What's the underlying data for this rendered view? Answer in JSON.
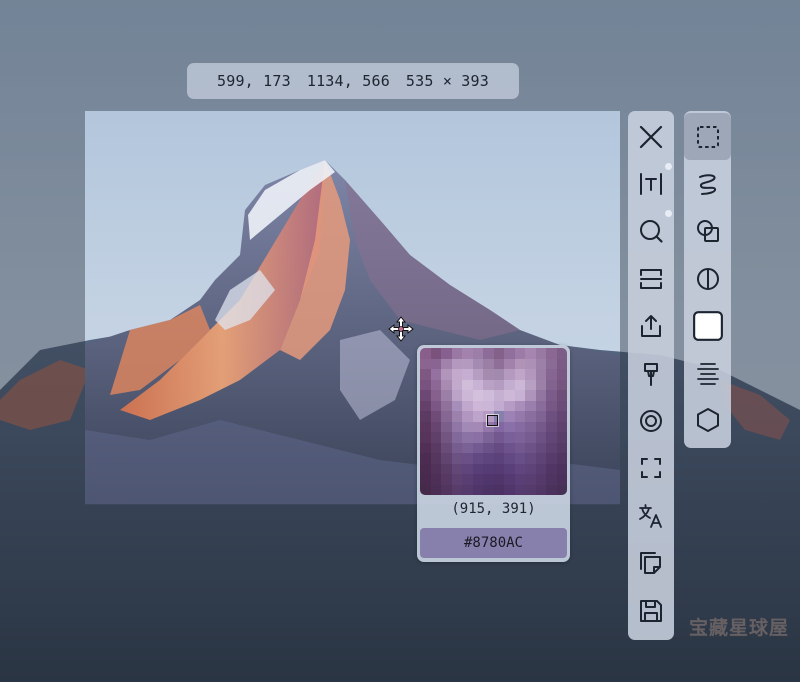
{
  "selection": {
    "start": "599, 173",
    "end": "1134, 566",
    "size": "535 × 393"
  },
  "magnifier": {
    "position": "(915, 391)",
    "color_hex": "#8780AC",
    "pixels": [
      "#8a5e8a",
      "#7a527c",
      "#87608f",
      "#9a78a4",
      "#a383ad",
      "#9d7ea8",
      "#8e6c99",
      "#836189",
      "#906f9c",
      "#9d7ba7",
      "#a686b0",
      "#9879a2",
      "#8a6893",
      "#7d5c86",
      "#8c6490",
      "#8a6593",
      "#a182ab",
      "#b498bd",
      "#b59ac0",
      "#a48bb1",
      "#9b7fa5",
      "#8f6e98",
      "#a282ab",
      "#b193b8",
      "#ad90b6",
      "#9d80a8",
      "#8a6b95",
      "#7b5a85",
      "#7f5882",
      "#9471a0",
      "#b295bb",
      "#c3a9cb",
      "#c5aed1",
      "#b69dc2",
      "#a58caf",
      "#a28aaf",
      "#b59ac0",
      "#c0a5c8",
      "#b397bc",
      "#9b7ea6",
      "#866592",
      "#7a5884",
      "#7a5280",
      "#8d6897",
      "#a98bb1",
      "#c2aacd",
      "#d0bdda",
      "#c9b3d4",
      "#b9a2c4",
      "#b49cc0",
      "#c4aed0",
      "#ccb7d6",
      "#b8a0c3",
      "#9c80a8",
      "#82628f",
      "#76557f",
      "#6e4874",
      "#86618d",
      "#9c7fa6",
      "#bba2c7",
      "#cdb7d7",
      "#d3c0dd",
      "#cfbcda",
      "#c6b0d1",
      "#cdb9d7",
      "#c8b2d3",
      "#ae94bb",
      "#9275a0",
      "#7b5b89",
      "#6f4f7a",
      "#654068",
      "#7c5684",
      "#90719b",
      "#a78dba",
      "#c0a7cc",
      "#cdb6d7",
      "#ccb6d7",
      "#c2abd0",
      "#b69cc5",
      "#a98ebb",
      "#9a7eab",
      "#8a6c9a",
      "#765785",
      "#6b4b77",
      "#5d3a61",
      "#6f4c78",
      "#866793",
      "#9c81ad",
      "#b196c1",
      "#bda4ca",
      "#b59bc3",
      "#8780AC",
      "#9c82b5",
      "#9479aa",
      "#8a6ea0",
      "#7f6393",
      "#6e5080",
      "#654673",
      "#5a365d",
      "#684570",
      "#7c5e8b",
      "#8f76a6",
      "#a28ab7",
      "#a489b6",
      "#9277a8",
      "#8267a0",
      "#8a70a8",
      "#866aa2",
      "#7f6498",
      "#76598b",
      "#694b7b",
      "#60426f",
      "#57345a",
      "#603f68",
      "#725581",
      "#82699b",
      "#8c73a6",
      "#8a70a4",
      "#7c6398",
      "#72588f",
      "#7a609a",
      "#7d6299",
      "#775c91",
      "#6d5185",
      "#634678",
      "#5b3f6b",
      "#523056",
      "#5a3a62",
      "#694d78",
      "#775d8f",
      "#7a6196",
      "#735a90",
      "#6b5288",
      "#654b82",
      "#6d538e",
      "#735890",
      "#6d5288",
      "#654a7e",
      "#5c4171",
      "#563b66",
      "#4d2c52",
      "#55365c",
      "#614470",
      "#6c5283",
      "#6a5087",
      "#624982",
      "#5e457d",
      "#5c427a",
      "#634984",
      "#694f87",
      "#654a80",
      "#5e4377",
      "#563b6b",
      "#513662",
      "#4a2a4f",
      "#513258",
      "#5a3d67",
      "#634877",
      "#5f457c",
      "#583f77",
      "#553c74",
      "#553b72",
      "#5a407a",
      "#60457f",
      "#5e4379",
      "#583d70",
      "#513665",
      "#4d325e",
      "#482a4e",
      "#4e3056",
      "#563862",
      "#5d4170",
      "#593e74",
      "#52386f",
      "#4f366c",
      "#4f356a",
      "#543a71",
      "#5a3f77",
      "#593e72",
      "#54396a",
      "#4e3461",
      "#4a305a",
      "#462a4c",
      "#4b2e53",
      "#52355e",
      "#583c6a",
      "#553a6e",
      "#4f3569",
      "#4c3366",
      "#4c3264",
      "#50366a",
      "#553b70",
      "#553a6c",
      "#513765",
      "#4b325d",
      "#473056"
    ]
  },
  "toolbar_main": {
    "tools": [
      {
        "name": "close",
        "icon": "close-icon"
      },
      {
        "name": "text",
        "icon": "text-icon"
      },
      {
        "name": "search",
        "icon": "search-icon"
      },
      {
        "name": "scroll",
        "icon": "scroll-capture-icon"
      },
      {
        "name": "share",
        "icon": "share-icon"
      },
      {
        "name": "pin",
        "icon": "pin-icon"
      },
      {
        "name": "record",
        "icon": "record-icon"
      },
      {
        "name": "crop",
        "icon": "crop-icon"
      },
      {
        "name": "translate",
        "icon": "translate-icon"
      },
      {
        "name": "copy",
        "icon": "copy-icon"
      },
      {
        "name": "save",
        "icon": "save-icon"
      }
    ]
  },
  "toolbar_shapes": {
    "tools": [
      {
        "name": "rectangle-select",
        "icon": "dashed-rect-icon",
        "active": true
      },
      {
        "name": "freehand",
        "icon": "freehand-icon"
      },
      {
        "name": "shapes",
        "icon": "shapes-icon"
      },
      {
        "name": "contrast",
        "icon": "contrast-icon"
      },
      {
        "name": "color",
        "icon": "color-swatch-icon",
        "color": "#ffffff"
      },
      {
        "name": "align",
        "icon": "align-center-icon"
      },
      {
        "name": "polygon",
        "icon": "hexagon-icon"
      }
    ]
  },
  "watermark": {
    "text": "宝藏星球屋"
  }
}
